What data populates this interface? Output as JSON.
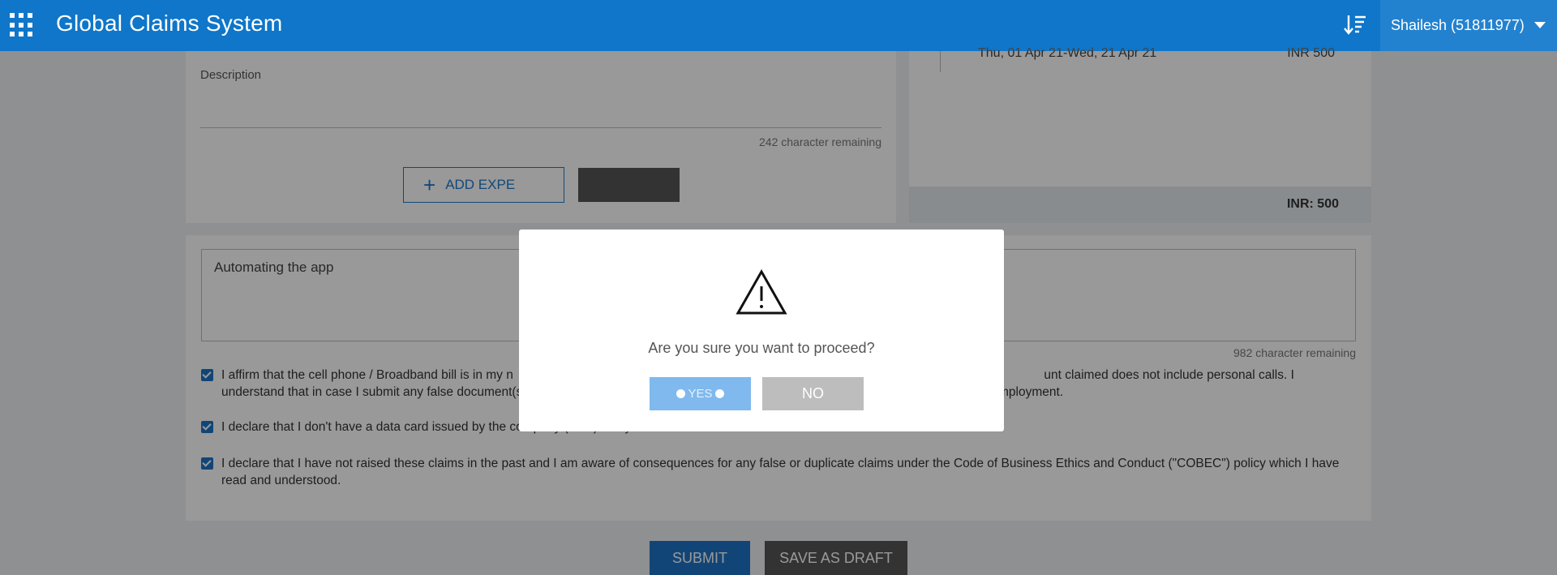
{
  "header": {
    "title": "Global Claims System",
    "user": "Shailesh (51811977)"
  },
  "expense_form": {
    "description_label": "Description",
    "char_remaining": "242 character remaining",
    "add_expense_label": "ADD EXPE"
  },
  "summary": {
    "date_range": "Thu, 01 Apr 21-Wed, 21 Apr 21",
    "amount": "INR 500",
    "total": "INR: 500"
  },
  "comments": {
    "value": "Automating the app",
    "char_remaining": "982 character remaining"
  },
  "declarations": [
    {
      "checked": true,
      "text": "I affirm that the cell phone / Broadband bill is in my n                                                                                                                                                        unt claimed does not include personal calls. I understand that in case I submit any false document(s) / declaration, the same may result in disciplinary action including termination of my employment."
    },
    {
      "checked": true,
      "text": "I declare that I don't have a data card issued by the company (HCL) in my name."
    },
    {
      "checked": true,
      "text": "I declare that I have not raised these claims in the past and I am aware of consequences for any false or duplicate claims under the Code of Business Ethics and Conduct (\"COBEC\") policy which I have read and understood."
    }
  ],
  "actions": {
    "submit": "SUBMIT",
    "save_draft": "SAVE AS DRAFT"
  },
  "modal": {
    "message": "Are you sure you want to proceed?",
    "yes": "YES",
    "no": "NO",
    "icon": "warning-icon"
  },
  "colors": {
    "header": "#0f76c9",
    "primary": "#1f74c7",
    "yes_loading": "#7fb9ee",
    "no": "#bdbdbd"
  }
}
